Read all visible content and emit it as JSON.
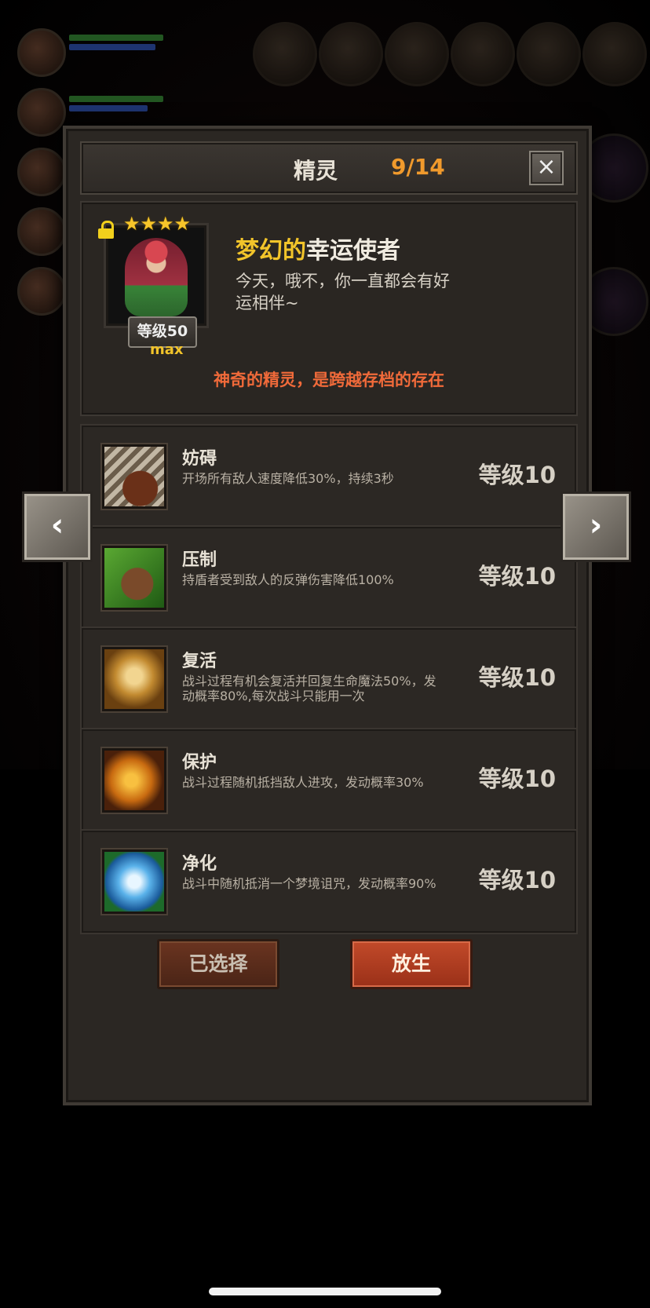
{
  "header": {
    "title": "精灵",
    "count": "9/14",
    "close_icon": "×"
  },
  "sprite": {
    "name_adjective": "梦幻的",
    "name_rest": "幸运使者",
    "description": "今天，哦不，你一直都会有好运相伴~",
    "level_badge": "等级50",
    "max_label": "max",
    "stars": 4,
    "tagline": "神奇的精灵，是跨越存档的存在"
  },
  "skills": [
    {
      "name": "妨碍",
      "desc": "开场所有敌人速度降低30%，持续3秒",
      "level": "等级10",
      "icon": "chain-boot-icon"
    },
    {
      "name": "压制",
      "desc": "持盾者受到敌人的反弹伤害降低100%",
      "level": "等级10",
      "icon": "claw-icon"
    },
    {
      "name": "复活",
      "desc": "战斗过程有机会复活并回复生命魔法50%，发动概率80%,每次战斗只能用一次",
      "level": "等级10",
      "icon": "revive-icon"
    },
    {
      "name": "保护",
      "desc": "战斗过程随机抵挡敌人进攻，发动概率30%",
      "level": "等级10",
      "icon": "fairy-shield-icon"
    },
    {
      "name": "净化",
      "desc": "战斗中随机抵消一个梦境诅咒，发动概率90%",
      "level": "等级10",
      "icon": "blue-flower-icon"
    }
  ],
  "buttons": {
    "selected": "已选择",
    "release": "放生"
  },
  "nav": {
    "prev": "‹",
    "next": "›"
  },
  "colors": {
    "accent_orange": "#f09a2c",
    "gold": "#f2c42a",
    "tagline": "#f06a3a",
    "release_button": "#c24a2a"
  }
}
